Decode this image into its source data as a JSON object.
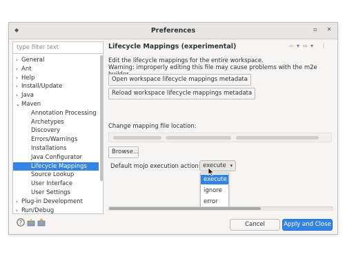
{
  "window": {
    "title": "Preferences"
  },
  "sidebar": {
    "filter_placeholder": "type filter text",
    "items": [
      {
        "label": "General",
        "arrow": "›"
      },
      {
        "label": "Ant",
        "arrow": "›"
      },
      {
        "label": "Help",
        "arrow": "›"
      },
      {
        "label": "Install/Update",
        "arrow": "›"
      },
      {
        "label": "Java",
        "arrow": "›"
      },
      {
        "label": "Maven",
        "arrow": "⌄"
      },
      {
        "label": "Annotation Processing"
      },
      {
        "label": "Archetypes"
      },
      {
        "label": "Discovery"
      },
      {
        "label": "Errors/Warnings"
      },
      {
        "label": "Installations"
      },
      {
        "label": "Java Configurator"
      },
      {
        "label": "Lifecycle Mappings"
      },
      {
        "label": "Source Lookup"
      },
      {
        "label": "User Interface"
      },
      {
        "label": "User Settings"
      },
      {
        "label": "Plug-in Development",
        "arrow": "›"
      },
      {
        "label": "Run/Debug",
        "arrow": "›"
      }
    ]
  },
  "panel": {
    "title": "Lifecycle Mappings (experimental)",
    "desc_line1": "Edit the lifecycle mappings for the entire workspace.",
    "desc_line2": "Warning: improperly editing this file may cause problems with the m2e builder.",
    "open_button": "Open workspace lifecycle mappings metadata",
    "reload_button": "Reload workspace lifecycle mappings metadata",
    "location_label": "Change mapping file location:",
    "browse_button": "Browse...",
    "mojo_label": "Default mojo execution action:",
    "mojo_selected": "execute",
    "mojo_options": [
      "execute",
      "ignore",
      "error"
    ]
  },
  "footer": {
    "cancel": "Cancel",
    "apply_close": "Apply and Close"
  },
  "colors": {
    "accent": "#3584e4",
    "window_bg": "#f6f5f4"
  }
}
